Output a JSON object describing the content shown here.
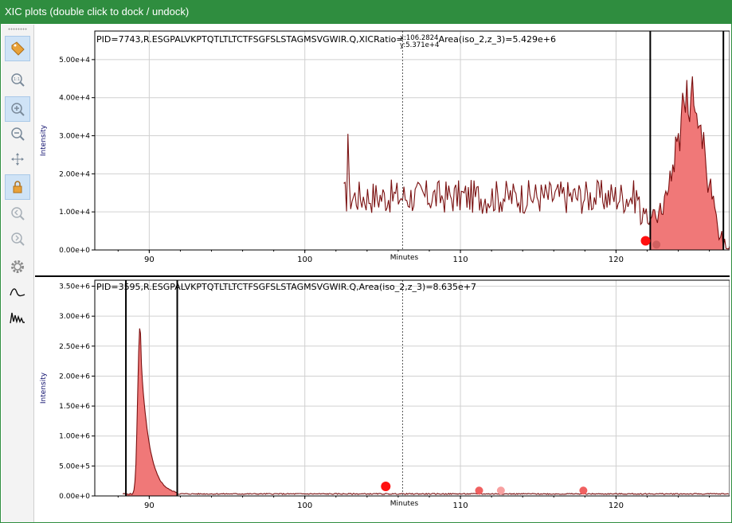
{
  "window": {
    "title": "XIC plots (double click to dock / undock)",
    "accent": "#2f8d3f"
  },
  "toolbar": {
    "buttons": [
      {
        "name": "label-tag-icon",
        "active": true
      },
      {
        "name": "zoom-fit-icon",
        "active": false
      },
      {
        "name": "zoom-in-icon",
        "active": true
      },
      {
        "name": "zoom-out-icon",
        "active": false
      },
      {
        "name": "pan-move-icon",
        "active": false
      },
      {
        "name": "lock-icon",
        "active": true
      },
      {
        "name": "zoom-prev-icon",
        "active": false
      },
      {
        "name": "zoom-next-icon",
        "active": false
      },
      {
        "name": "settings-gear-icon",
        "active": false
      },
      {
        "name": "smooth-curve-icon",
        "active": false
      },
      {
        "name": "raw-peaks-icon",
        "active": false
      }
    ]
  },
  "plot_top": {
    "header": "PID=7743,R.ESGPALVKPTQTLTLTCTFSGFSLSTAGMSVGWIR.Q,XICRatio=",
    "header_tail": "Area(iso_2,z_3)=5.429e+6",
    "cursor_x": "x:106.2824",
    "cursor_y": "y:5.371e+4",
    "xlabel": "Minutes",
    "ylabel": "Intensity",
    "y_ticks": [
      "0.00e+0",
      "1.00e+4",
      "2.00e+4",
      "3.00e+4",
      "4.00e+4",
      "5.00e+4"
    ],
    "x_ticks": [
      "90",
      "100",
      "110",
      "120"
    ]
  },
  "plot_bottom": {
    "header": "PID=3595,R.ESGPALVKPTQTLTLTCTFSGFSLSTAGMSVGWIR.Q,Area(iso_2,z_3)=8.635e+7",
    "xlabel": "Minutes",
    "ylabel": "Intensity",
    "y_ticks": [
      "0.00e+0",
      "5.00e+5",
      "1.00e+6",
      "1.50e+6",
      "2.00e+6",
      "2.50e+6",
      "3.00e+6",
      "3.50e+6"
    ],
    "x_ticks": [
      "90",
      "100",
      "110",
      "120"
    ]
  },
  "chart_data": [
    {
      "type": "line",
      "xlim": [
        86.5,
        127.3
      ],
      "ylim": [
        0,
        57500
      ],
      "grid": true,
      "cursor_x": 106.2824,
      "integration_bounds": [
        122.2,
        126.9
      ],
      "series_color": "#7a1010",
      "fill_color": "#f07878",
      "noise": {
        "x_start": 102.5,
        "x_end": 121.5,
        "base": 14000,
        "amp": 4500
      },
      "spike": {
        "x": 102.8,
        "y": 30500
      },
      "peak": {
        "x_center": 124.8,
        "sigma": 0.9,
        "height": 42000
      },
      "markers": [
        {
          "x": 121.9,
          "y": 2400,
          "color": "#ff1010"
        },
        {
          "x": 122.6,
          "y": 1400,
          "color": "#d06060"
        }
      ]
    },
    {
      "type": "line",
      "xlim": [
        86.5,
        127.3
      ],
      "ylim": [
        0,
        3600000
      ],
      "grid": true,
      "cursor_x": 106.2824,
      "integration_bounds": [
        88.5,
        91.8
      ],
      "series_color": "#7a1010",
      "fill_color": "#f07878",
      "peak": {
        "x_center": 89.4,
        "height": 2800000
      },
      "markers": [
        {
          "x": 105.2,
          "y": 160000,
          "color": "#ff1010"
        },
        {
          "x": 111.2,
          "y": 90000,
          "color": "#f06060"
        },
        {
          "x": 112.6,
          "y": 90000,
          "color": "#f8a0a0"
        },
        {
          "x": 117.9,
          "y": 90000,
          "color": "#f06060"
        }
      ]
    }
  ]
}
